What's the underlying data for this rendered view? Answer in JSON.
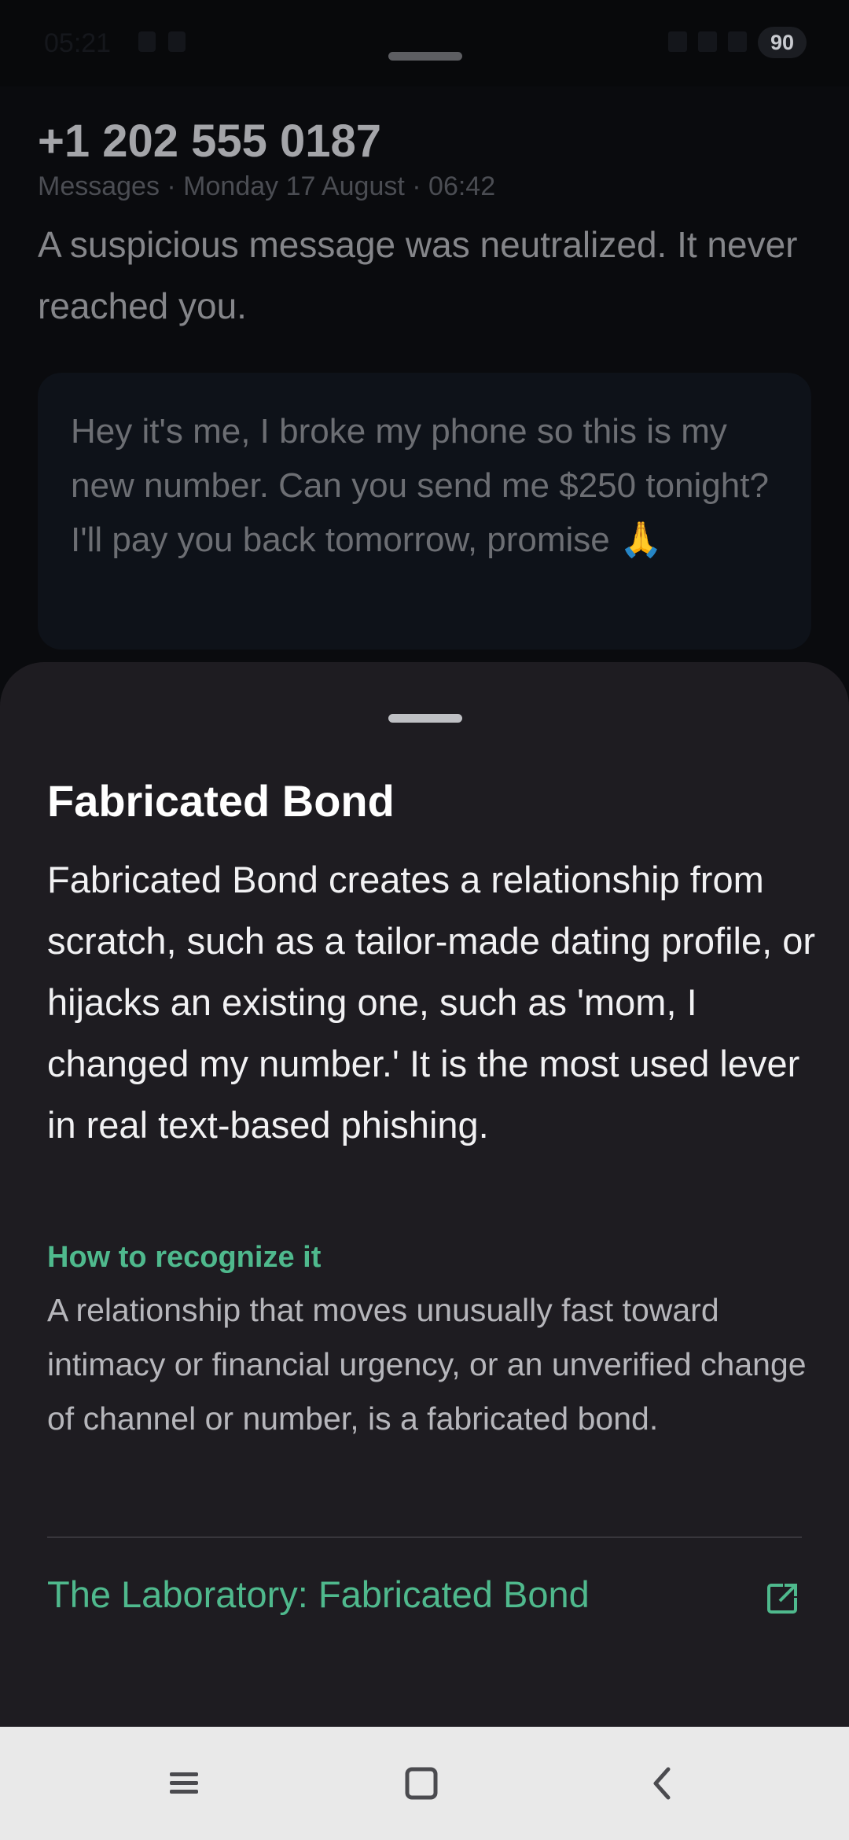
{
  "status_bar": {
    "time": "05:21",
    "battery": "90"
  },
  "message": {
    "sender": "+1 202 555 0187",
    "meta": "Messages · Monday 17 August · 06:42",
    "summary": "A suspicious message was neutralized. It never reached you.",
    "body": "Hey it's me, I broke my phone so this is my new number. Can you send me $250 tonight? I'll pay you back tomorrow, promise 🙏"
  },
  "sheet": {
    "title": "Fabricated Bond",
    "description": "Fabricated Bond creates a relationship from scratch, such as a tailor-made dating profile, or hijacks an existing one, such as 'mom, I changed my number.' It is the most used lever in real text-based phishing.",
    "recognize_heading": "How to recognize it",
    "recognize_body": "A relationship that moves unusually fast toward intimacy or financial urgency, or an unverified change of channel or number, is a fabricated bond.",
    "link_label": "The Laboratory: Fabricated Bond",
    "link_icon": "external-link-icon"
  },
  "colors": {
    "accent": "#4fb98d",
    "sheet_bg": "#1e1c21",
    "page_bg": "#0a0b0e"
  },
  "nav": {
    "icons": [
      "menu-icon",
      "home-square-icon",
      "back-chevron-icon"
    ]
  }
}
